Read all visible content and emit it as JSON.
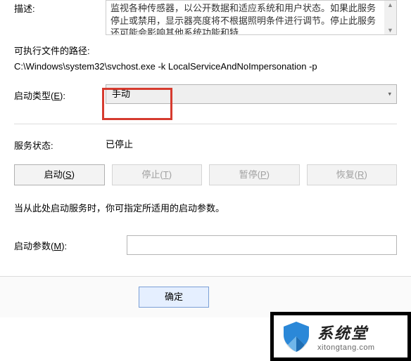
{
  "description": {
    "label": "描述:",
    "text": "监视各种传感器，以公开数据和适应系统和用户状态。如果此服务停止或禁用，显示器亮度将不根据照明条件进行调节。停止此服务还可能会影响其他系统功能和特"
  },
  "exec_path": {
    "label": "可执行文件的路径:",
    "value": "C:\\Windows\\system32\\svchost.exe -k LocalServiceAndNoImpersonation -p"
  },
  "startup": {
    "label_pre": "启动类型(",
    "label_key": "E",
    "label_post": "):",
    "value": "手动"
  },
  "status": {
    "label": "服务状态:",
    "value": "已停止"
  },
  "buttons": {
    "start_pre": "启动(",
    "start_key": "S",
    "start_post": ")",
    "stop_pre": "停止(",
    "stop_key": "T",
    "stop_post": ")",
    "pause_pre": "暂停(",
    "pause_key": "P",
    "pause_post": ")",
    "resume_pre": "恢复(",
    "resume_key": "R",
    "resume_post": ")"
  },
  "hint": "当从此处启动服务时，你可指定所适用的启动参数。",
  "params": {
    "label_pre": "启动参数(",
    "label_key": "M",
    "label_post": "):",
    "value": ""
  },
  "footer": {
    "ok": "确定"
  },
  "watermark": {
    "title": "系统堂",
    "url": "xitongtang.com"
  }
}
